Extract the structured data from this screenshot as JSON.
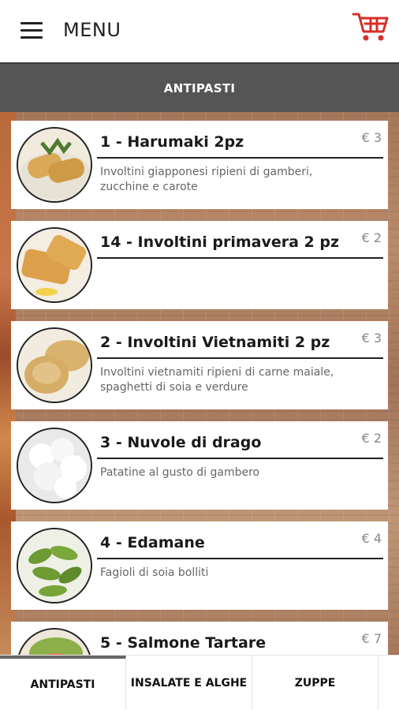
{
  "header": {
    "menu_label": "MENU",
    "cart_color": "#d52f2a"
  },
  "section": {
    "title": "ANTIPASTI"
  },
  "dishes": [
    {
      "name": "1 - Harumaki 2pz",
      "price": "€ 3",
      "description": "Involtini giapponesi ripieni di gamberi, zucchine e carote"
    },
    {
      "name": "14 - Involtini primavera 2 pz",
      "price": "€ 2",
      "description": ""
    },
    {
      "name": "2 - Involtini Vietnamiti 2 pz",
      "price": "€ 3",
      "description": "Involtini vietnamiti ripieni di carne maiale, spaghetti di soia e verdure"
    },
    {
      "name": "3 - Nuvole di drago",
      "price": "€ 2",
      "description": "Patatine al gusto di gambero"
    },
    {
      "name": "4 - Edamane",
      "price": "€ 4",
      "description": "Fagioli di soia bolliti"
    },
    {
      "name": "5 - Salmone Tartare",
      "price": "€ 7",
      "description": ""
    }
  ],
  "tabs": [
    {
      "label": "ANTIPASTI",
      "active": true
    },
    {
      "label": "INSALATE E ALGHE",
      "active": false
    },
    {
      "label": "ZUPPE",
      "active": false
    }
  ]
}
